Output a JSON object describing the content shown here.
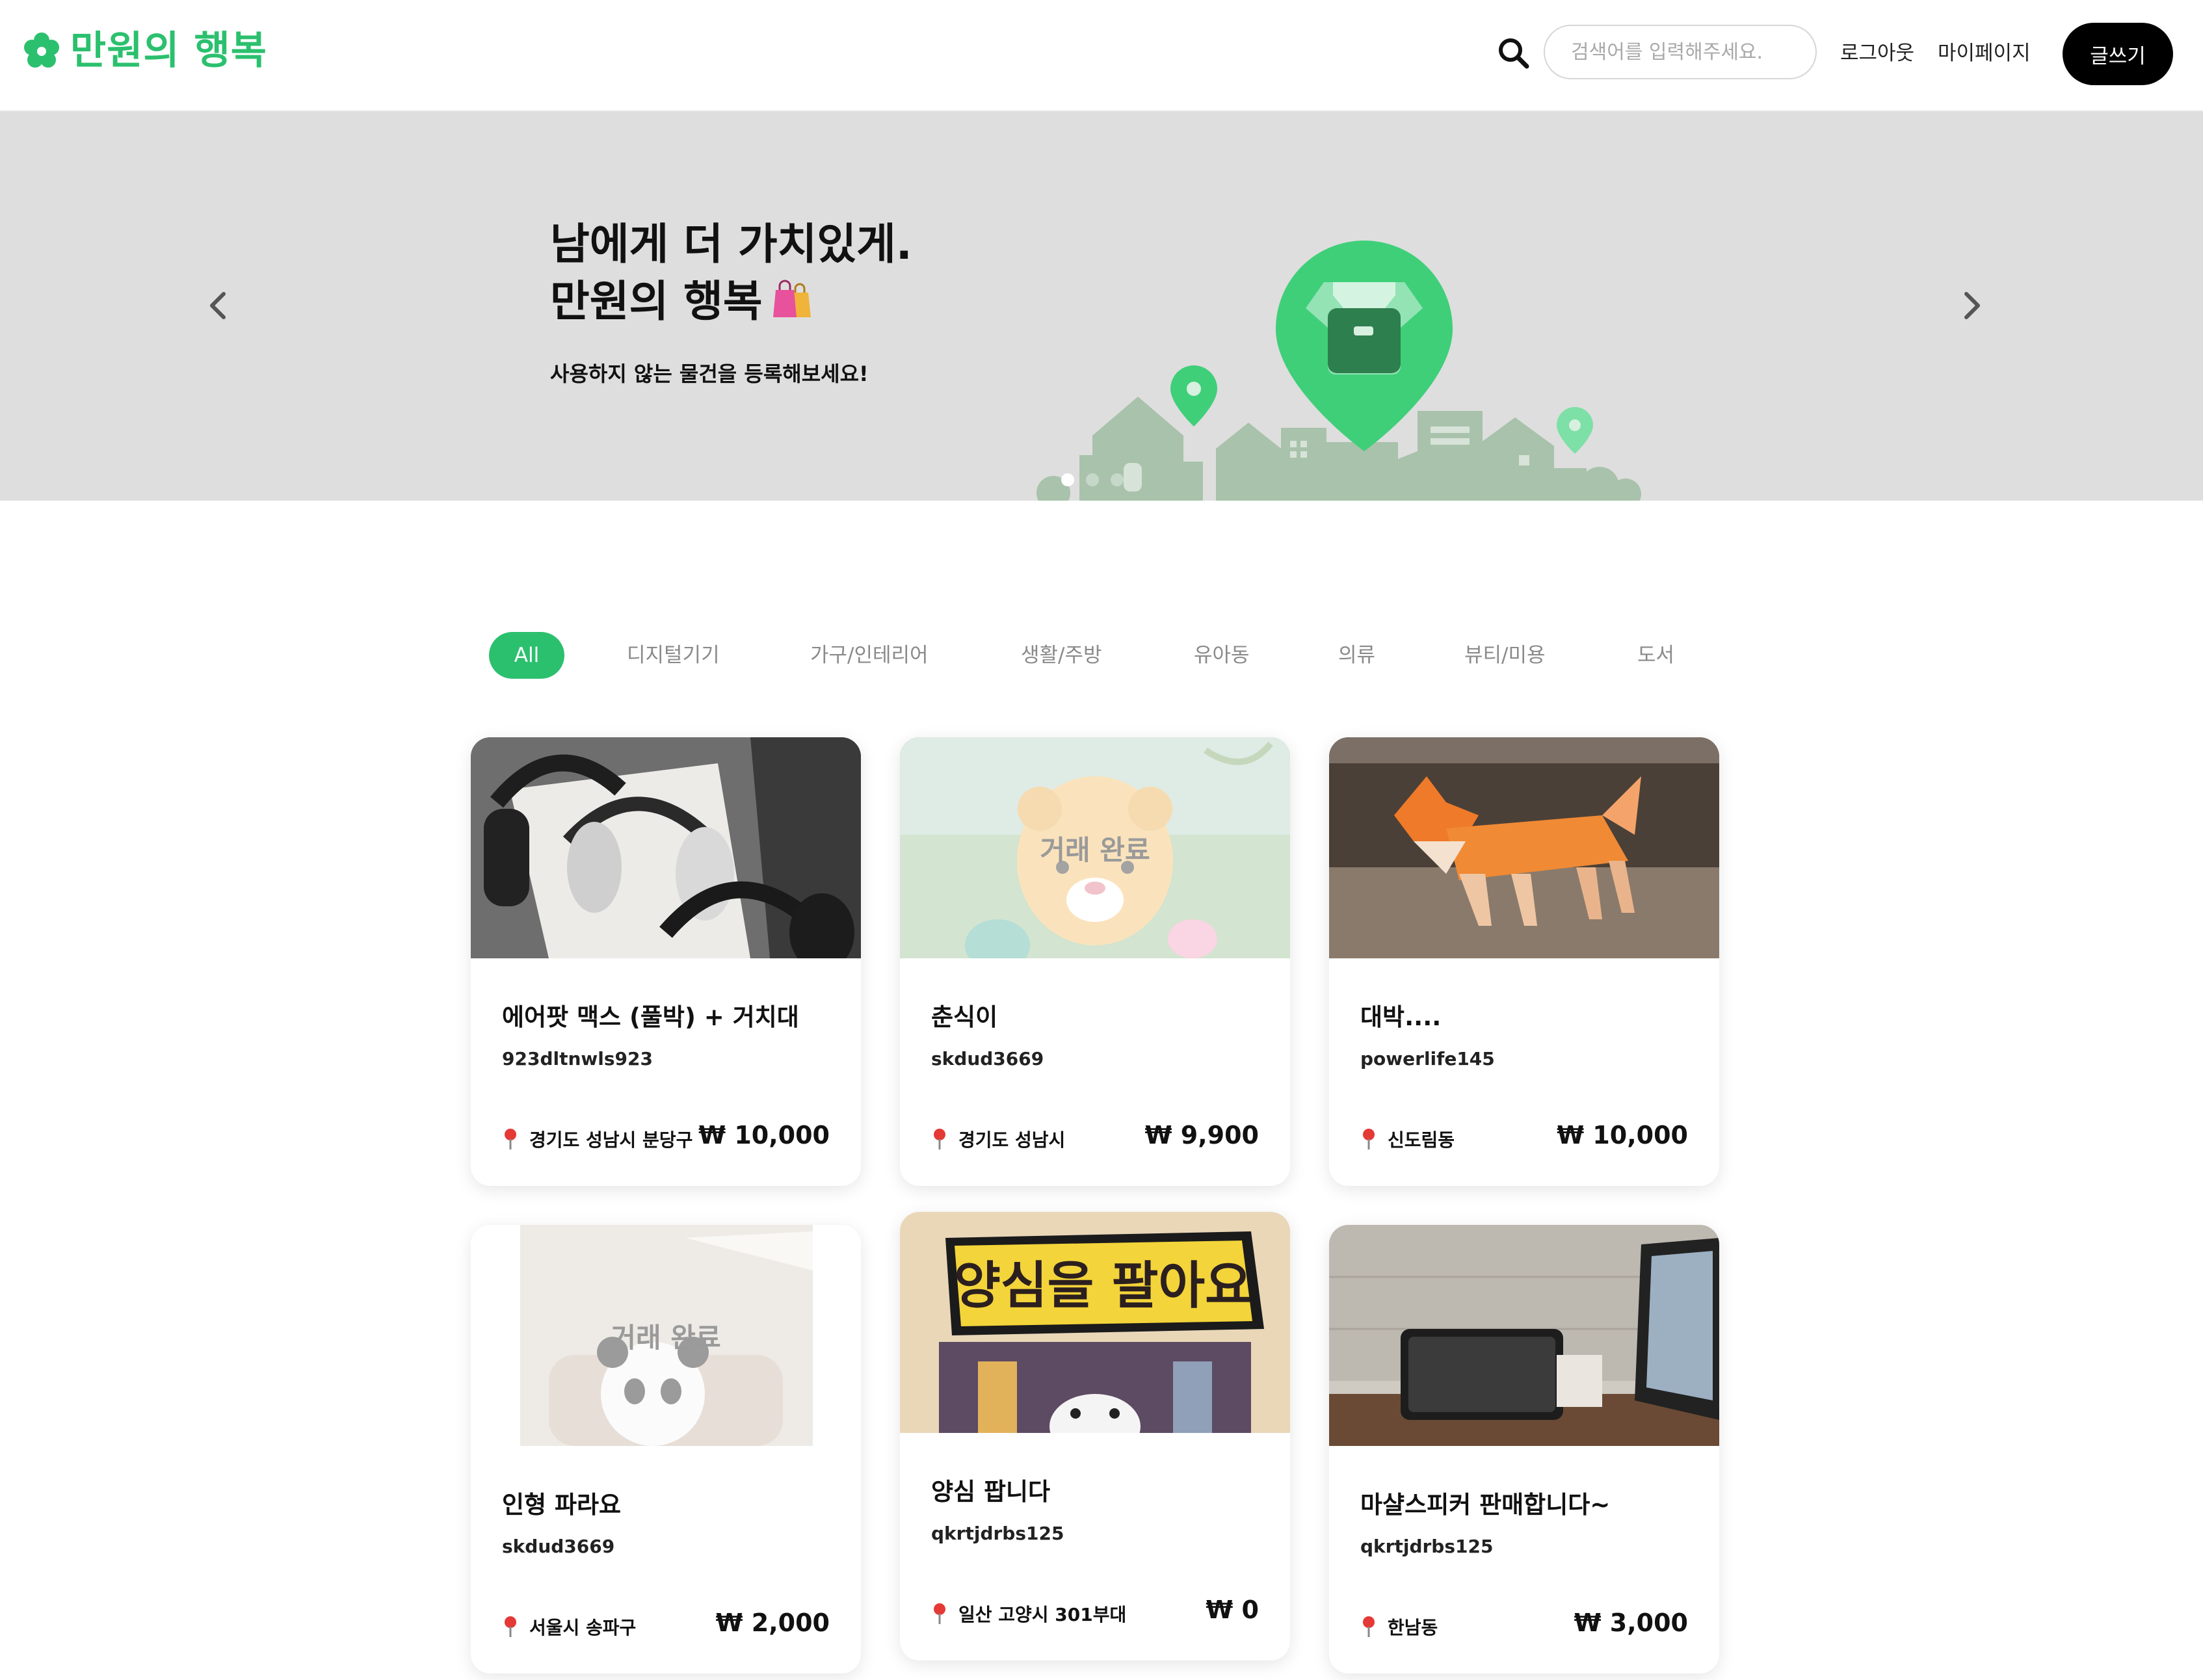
{
  "header": {
    "logo_text": "만원의 행복",
    "search_placeholder": "검색어를 입력해주세요.",
    "logout_label": "로그아웃",
    "mypage_label": "마이페이지",
    "write_label": "글쓰기"
  },
  "hero": {
    "title_line1": "남에게 더 가치있게.",
    "title_line2": "만원의 행복",
    "subtitle": "사용하지 않는 물건을 등록해보세요!",
    "slide_index": 1,
    "slide_count": 3
  },
  "categories": [
    "All",
    "디지털기기",
    "가구/인테리어",
    "생활/주방",
    "유아동",
    "의류",
    "뷰티/미용",
    "도서"
  ],
  "active_category": "All",
  "sold_label": "거래 완료",
  "products": [
    {
      "title": "에어팟 맥스 (풀박) + 거치대",
      "seller": "923dltnwls923",
      "location": "경기도 성남시 분당구",
      "price": "₩ 10,000",
      "sold": false,
      "image": "headphones"
    },
    {
      "title": "춘식이",
      "seller": "skdud3669",
      "location": "경기도 성남시",
      "price": "₩ 9,900",
      "sold": true,
      "image": "plush-toy"
    },
    {
      "title": "대박....",
      "seller": "powerlife145",
      "location": "신도림동",
      "price": "₩ 10,000",
      "sold": false,
      "image": "origami-dog"
    },
    {
      "title": "인형 파라요",
      "seller": "skdud3669",
      "location": "서울시 송파구",
      "price": "₩ 2,000",
      "sold": true,
      "image": "panda-doll"
    },
    {
      "title": "양심 팝니다",
      "seller": "qkrtjdrbs125",
      "location": "일산 고양시 301부대",
      "price": "₩ 0",
      "sold": false,
      "image": "book-cover",
      "image_text": "양심을 팔아요"
    },
    {
      "title": "마샬스피커 판매합니다~",
      "seller": "qkrtjdrbs125",
      "location": "한남동",
      "price": "₩ 3,000",
      "sold": false,
      "image": "speaker"
    }
  ],
  "colors": {
    "accent": "#2bc06e",
    "hero_bg": "#dedede",
    "button_dark": "#000000"
  }
}
